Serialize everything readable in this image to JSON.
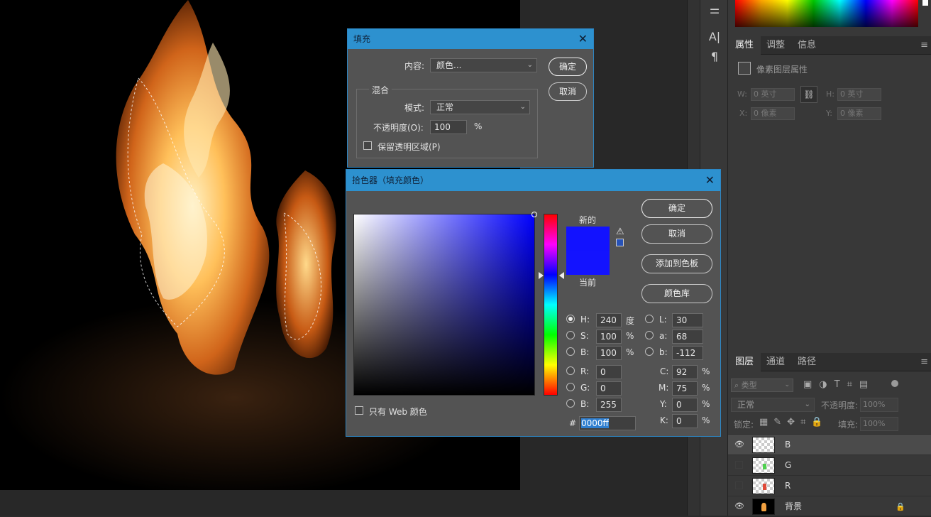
{
  "fill_dialog": {
    "title": "填充",
    "content_label": "内容:",
    "content_value": "颜色...",
    "ok": "确定",
    "cancel": "取消",
    "blend_group": "混合",
    "mode_label": "模式:",
    "mode_value": "正常",
    "opacity_label": "不透明度(O):",
    "opacity_value": "100",
    "opacity_unit": "%",
    "preserve_label": "保留透明区域(P)"
  },
  "picker_dialog": {
    "title": "拾色器（填充颜色）",
    "new_label": "新的",
    "current_label": "当前",
    "ok": "确定",
    "cancel": "取消",
    "add_swatch": "添加到色板",
    "color_libraries": "颜色库",
    "web_only": "只有 Web 颜色",
    "new_color": "#1212ff",
    "current_color": "#1313ff",
    "fields": {
      "H": {
        "label": "H:",
        "value": "240",
        "unit": "度"
      },
      "S": {
        "label": "S:",
        "value": "100",
        "unit": "%"
      },
      "Bv": {
        "label": "B:",
        "value": "100",
        "unit": "%"
      },
      "L": {
        "label": "L:",
        "value": "30"
      },
      "a": {
        "label": "a:",
        "value": "68"
      },
      "b": {
        "label": "b:",
        "value": "-112"
      },
      "R": {
        "label": "R:",
        "value": "0"
      },
      "G": {
        "label": "G:",
        "value": "0"
      },
      "B": {
        "label": "B:",
        "value": "255"
      },
      "C": {
        "label": "C:",
        "value": "92",
        "unit": "%"
      },
      "M": {
        "label": "M:",
        "value": "75",
        "unit": "%"
      },
      "Y": {
        "label": "Y:",
        "value": "0",
        "unit": "%"
      },
      "K": {
        "label": "K:",
        "value": "0",
        "unit": "%"
      }
    },
    "hex_label": "#",
    "hex_value": "0000ff"
  },
  "properties_panel": {
    "tabs": [
      "属性",
      "调整",
      "信息"
    ],
    "heading": "像素图层属性",
    "w_label": "W:",
    "w_value": "0 英寸",
    "h_label": "H:",
    "h_value": "0 英寸",
    "x_label": "X:",
    "x_value": "0 像素",
    "y_label": "Y:",
    "y_value": "0 像素"
  },
  "layers_panel": {
    "tabs": [
      "图层",
      "通道",
      "路径"
    ],
    "filter_label": "类型",
    "blend_mode": "正常",
    "opacity_label": "不透明度:",
    "opacity_value": "100%",
    "lock_label": "锁定:",
    "fill_label": "填充:",
    "fill_value": "100%",
    "layers": [
      {
        "name": "B",
        "visible": true,
        "selected": true
      },
      {
        "name": "G",
        "visible": false,
        "selected": false
      },
      {
        "name": "R",
        "visible": false,
        "selected": false
      },
      {
        "name": "背景",
        "visible": true,
        "selected": false
      }
    ]
  }
}
